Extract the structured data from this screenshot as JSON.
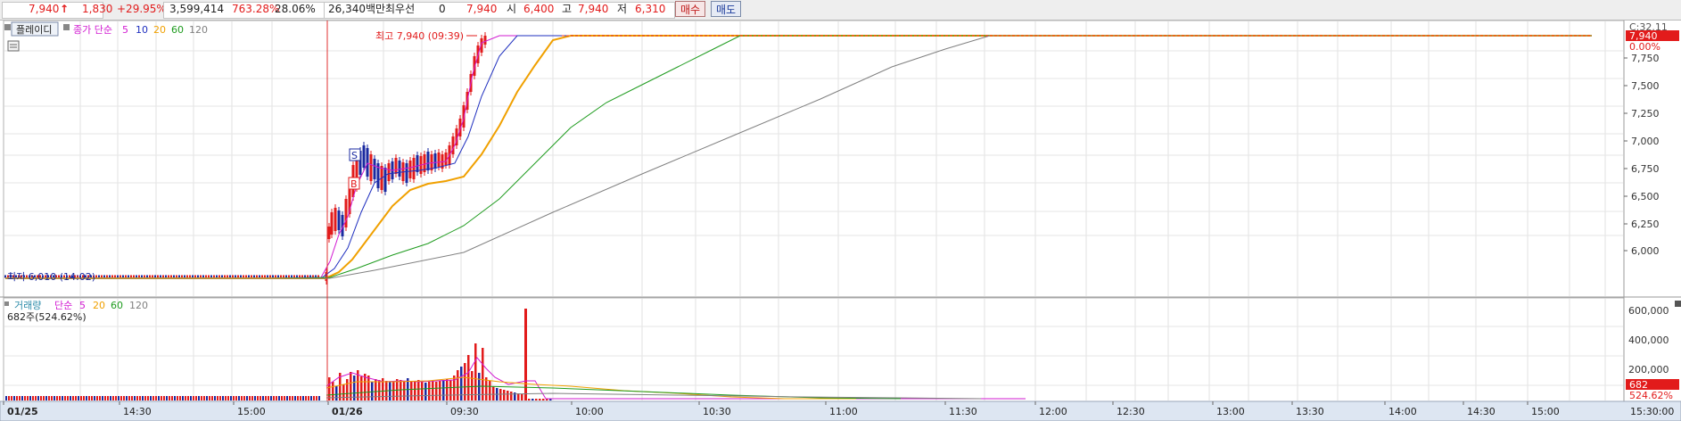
{
  "quote": {
    "price": "7,940",
    "arrow": "↑",
    "change": "1,830",
    "change_pct": "+29.95%",
    "volume": "3,599,414",
    "volume_ratio": "763.28%",
    "turnover": "28.06%",
    "amount": "26,340백만",
    "best_label": "최우선",
    "best_value": "0",
    "last": "7,940",
    "open_label": "시",
    "open": "6,400",
    "high_label": "고",
    "high": "7,940",
    "low_label": "저",
    "low": "6,310"
  },
  "buttons": {
    "buy": "매수",
    "sell": "매도"
  },
  "price_panel": {
    "playmode": "플레이디",
    "legend_title": "종가 단순",
    "ma_periods": [
      "5",
      "10",
      "20",
      "60",
      "120"
    ],
    "ma_colors": [
      "#d21bd2",
      "#1f2fbf",
      "#f0a000",
      "#1e9b1e",
      "#808080"
    ],
    "high_annotation": "최고 7,940 (09:39)",
    "low_annotation": "최저 6,010 (14:02)",
    "current_price_tag": "7,940",
    "current_pct_tag": "0.00%",
    "clock": "C:32.11",
    "y_ticks": [
      "7,750",
      "7,500",
      "7,250",
      "7,000",
      "6,750",
      "6,500",
      "6,250",
      "6,000"
    ]
  },
  "volume_panel": {
    "legend_title": "거래량",
    "legend_ma": "단순",
    "ma_periods": [
      "5",
      "20",
      "60",
      "120"
    ],
    "current": "682주(524.62%)",
    "y_ticks": [
      "600,000",
      "400,000",
      "200,000"
    ],
    "current_tag": "682",
    "current_pct_tag": "524.62%"
  },
  "x_axis": {
    "labels": [
      "01/25",
      "14:30",
      "15:00",
      "01/26",
      "09:30",
      "10:00",
      "10:30",
      "11:00",
      "11:30",
      "12:00",
      "12:30",
      "13:00",
      "13:30",
      "14:00",
      "14:30",
      "15:00"
    ],
    "right_label": "15:30:00"
  },
  "markers": {
    "sell": "S",
    "buy": "B"
  }
}
